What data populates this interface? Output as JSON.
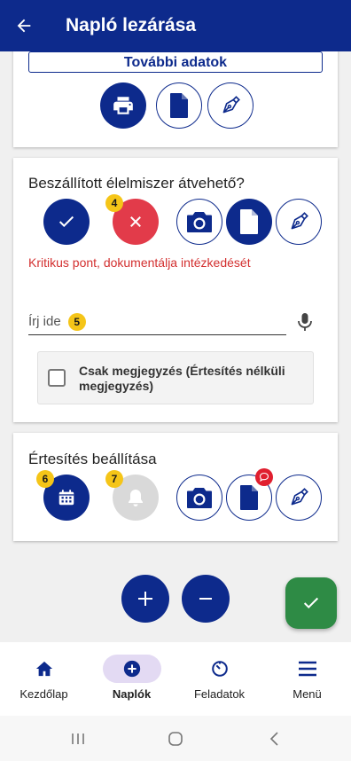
{
  "appbar": {
    "title": "Napló lezárása"
  },
  "card1": {
    "more_data_label": "További adatok"
  },
  "card2": {
    "question": "Beszállított élelmiszer átvehető?",
    "badge_no": "4",
    "warning": "Kritikus pont, dokumentálja intézkedését",
    "input_placeholder": "Írj ide",
    "badge_input": "5",
    "checkbox_label": "Csak megjegyzés (Értesítés nélküli megjegyzés)",
    "checkbox_checked": false
  },
  "card3": {
    "title": "Értesítés beállítása",
    "badge_calendar": "6",
    "badge_bell": "7"
  },
  "bottom_nav": {
    "items": [
      {
        "label": "Kezdőlap",
        "icon": "home-icon"
      },
      {
        "label": "Naplók",
        "icon": "add-circle-icon",
        "active": true
      },
      {
        "label": "Feladatok",
        "icon": "timer-icon"
      },
      {
        "label": "Menü",
        "icon": "menu-icon"
      }
    ]
  },
  "colors": {
    "primary": "#0d2a8c",
    "danger": "#e23b4a",
    "success": "#2e8b45",
    "badge": "#f5c518",
    "warning_text": "#d32f2f"
  }
}
